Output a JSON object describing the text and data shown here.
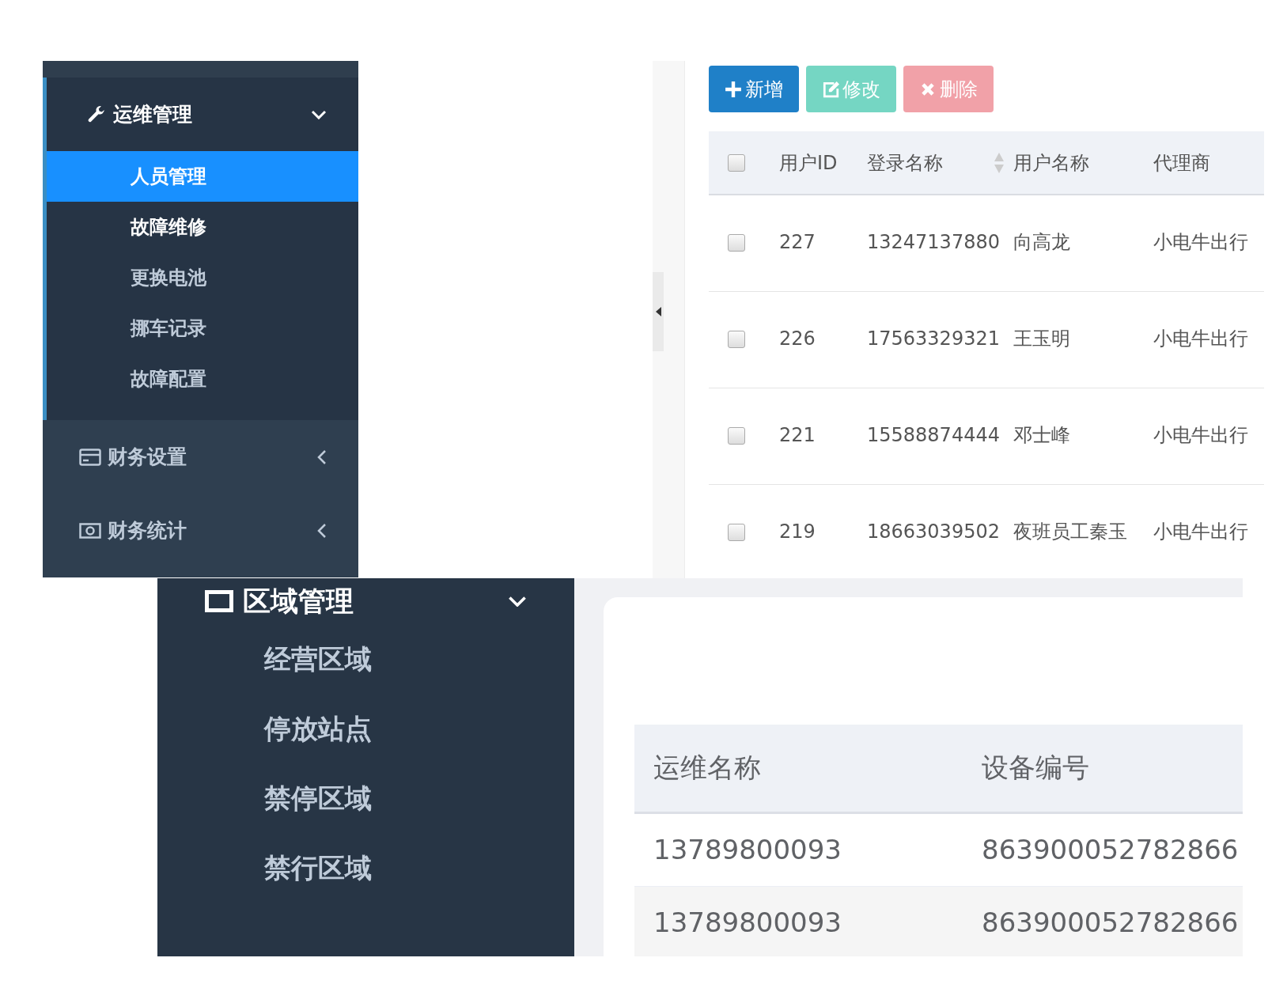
{
  "sidebar": {
    "groups": [
      {
        "kind": "wrench",
        "title": "运维管理",
        "expanded": true,
        "items": [
          {
            "label": "人员管理",
            "selected": true,
            "emphasized": false
          },
          {
            "label": "故障维修",
            "selected": false,
            "emphasized": true
          },
          {
            "label": "更换电池",
            "selected": false,
            "emphasized": false
          },
          {
            "label": "挪车记录",
            "selected": false,
            "emphasized": false
          },
          {
            "label": "故障配置",
            "selected": false,
            "emphasized": false
          }
        ]
      },
      {
        "kind": "card",
        "title": "财务设置",
        "expanded": false
      },
      {
        "kind": "cash",
        "title": "财务统计",
        "expanded": false
      }
    ]
  },
  "user_panel": {
    "buttons": [
      {
        "kind": "add",
        "label": "新增",
        "disabled": false
      },
      {
        "kind": "edit",
        "label": "修改",
        "disabled": true
      },
      {
        "kind": "delete",
        "label": "删除",
        "disabled": true
      }
    ],
    "table": {
      "select_all_checked": false,
      "columns": [
        {
          "label": "用户ID",
          "sortable": false
        },
        {
          "label": "登录名称",
          "sortable": true
        },
        {
          "label": "用户名称",
          "sortable": false
        },
        {
          "label": "代理商",
          "sortable": false
        }
      ],
      "rows": [
        {
          "checked": false,
          "cells": [
            "227",
            "13247137880",
            "向高龙",
            "小电牛出行"
          ]
        },
        {
          "checked": false,
          "cells": [
            "226",
            "17563329321",
            "王玉明",
            "小电牛出行"
          ]
        },
        {
          "checked": false,
          "cells": [
            "221",
            "15588874444",
            "邓士峰",
            "小电牛出行"
          ]
        },
        {
          "checked": false,
          "cells": [
            "219",
            "18663039502",
            "夜班员工秦玉",
            "小电牛出行"
          ]
        }
      ]
    }
  },
  "region_menu": {
    "title": "区域管理",
    "expanded": true,
    "items": [
      "经营区域",
      "停放站点",
      "禁停区域",
      "禁行区域"
    ]
  },
  "ops_table": {
    "columns": [
      "运维名称",
      "设备编号"
    ],
    "rows": [
      [
        "13789800093",
        "863900052782866"
      ],
      [
        "13789800093",
        "863900052782866"
      ]
    ]
  }
}
